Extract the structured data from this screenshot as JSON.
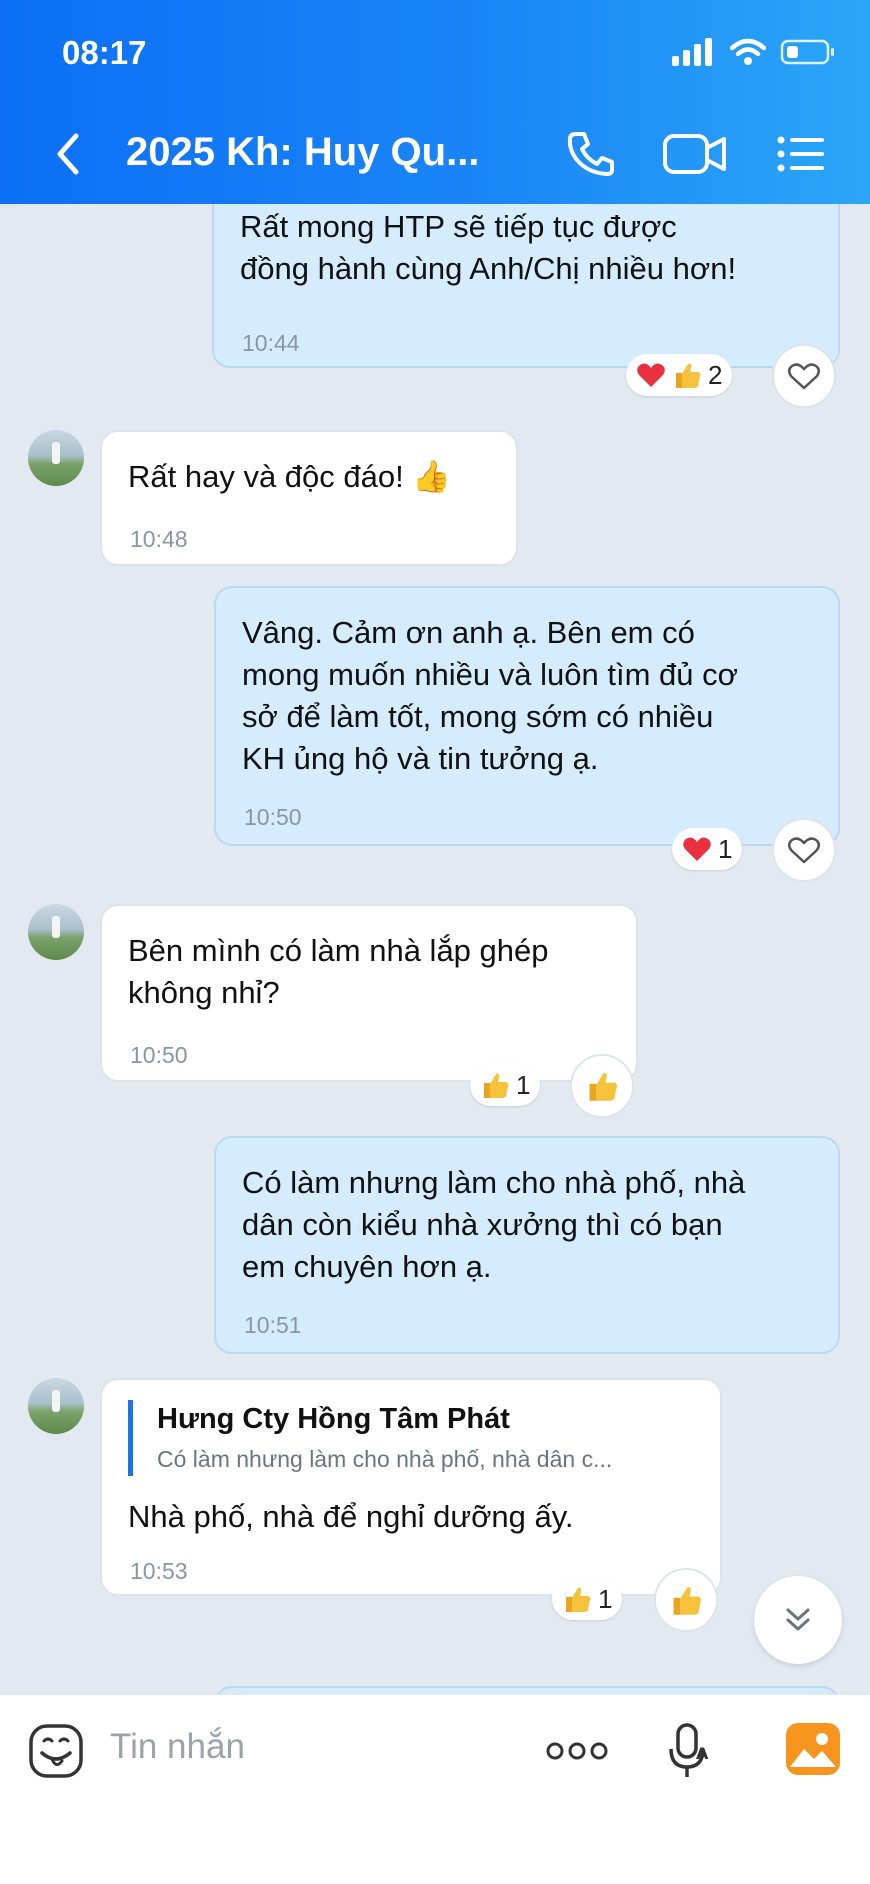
{
  "status": {
    "time": "08:17"
  },
  "header": {
    "title": "2025 Kh: Huy Qu..."
  },
  "messages": [
    {
      "text": "Rất mong HTP sẽ tiếp tục được\nđồng hành cùng Anh/Chị nhiều hơn!",
      "time": "10:44",
      "reaction_count": "2"
    },
    {
      "text": "Rất hay và độc đáo! 👍",
      "time": "10:48"
    },
    {
      "text": "Vâng. Cảm ơn anh ạ. Bên em có\nmong muốn nhiều và luôn tìm đủ cơ\nsở để làm tốt, mong sớm có nhiều\nKH ủng hộ và tin tưởng ạ.",
      "time": "10:50",
      "reaction_count": "1"
    },
    {
      "text": "Bên mình có làm nhà lắp ghép\nkhông nhỉ?",
      "time": "10:50",
      "reaction_count": "1"
    },
    {
      "text": "Có làm nhưng làm cho nhà phố, nhà\ndân còn kiểu nhà xưởng thì có bạn\nem chuyên hơn ạ.",
      "time": "10:51"
    },
    {
      "quote_name": "Hưng Cty Hồng Tâm Phát",
      "quote_text": "Có làm nhưng làm cho nhà phố, nhà dân c...",
      "text": "Nhà phố, nhà để nghỉ dưỡng ấy.",
      "time": "10:53",
      "reaction_count": "1"
    }
  ],
  "input": {
    "placeholder": "Tin nhắn"
  },
  "colors": {
    "header_start": "#0c6ff5",
    "header_end": "#2aa6f7",
    "outgoing_bubble": "#d4ecfd",
    "incoming_bubble": "#ffffff",
    "chat_background": "#e2e9f1"
  },
  "icons": [
    "back-icon",
    "phone-icon",
    "video-call-icon",
    "menu-list-icon",
    "heart-icon",
    "thumbs-up-icon",
    "scroll-down-icon",
    "sticker-icon",
    "more-options-icon",
    "voice-to-text-icon",
    "gallery-icon",
    "signal-icon",
    "wifi-icon",
    "battery-icon"
  ]
}
